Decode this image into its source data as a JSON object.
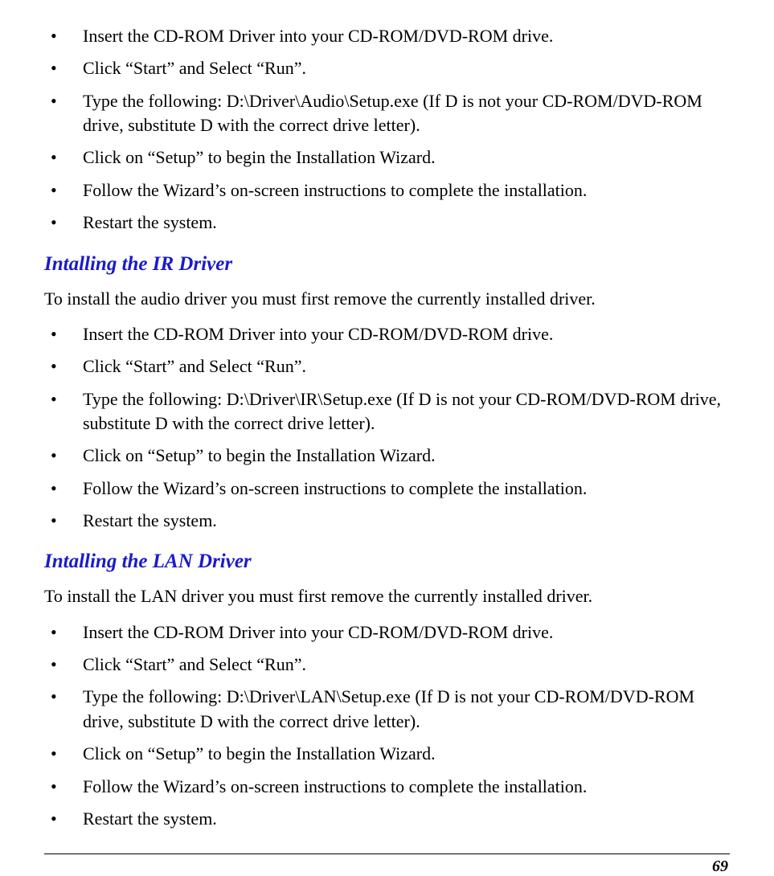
{
  "sections": [
    {
      "heading": null,
      "intro": null,
      "items": [
        "Insert the CD-ROM Driver into your CD-ROM/DVD-ROM drive.",
        "Click “Start” and Select “Run”.",
        "Type the following: D:\\Driver\\Audio\\Setup.exe (If D is not your CD-ROM/DVD-ROM drive, substitute D with the correct drive letter).",
        "Click on “Setup” to begin the Installation Wizard.",
        "Follow the Wizard’s on-screen instructions to complete the installation.",
        "Restart the system."
      ]
    },
    {
      "heading": "Intalling the IR Driver",
      "intro": "To install the audio driver you must first remove the currently installed driver.",
      "items": [
        "Insert the CD-ROM Driver into your CD-ROM/DVD-ROM drive.",
        "Click “Start” and Select “Run”.",
        "Type the following: D:\\Driver\\IR\\Setup.exe (If D is not your CD-ROM/DVD-ROM drive, substitute D with the correct drive letter).",
        "Click on “Setup” to begin the Installation Wizard.",
        "Follow the Wizard’s on-screen instructions to complete the installation.",
        "Restart the system."
      ]
    },
    {
      "heading": "Intalling the LAN Driver",
      "intro": "To install the LAN driver you must first remove the currently installed driver.",
      "items": [
        "Insert the CD-ROM Driver into your CD-ROM/DVD-ROM drive.",
        "Click “Start” and Select “Run”.",
        "Type the following: D:\\Driver\\LAN\\Setup.exe (If D is not your CD-ROM/DVD-ROM drive, substitute D with the correct drive letter).",
        "Click on “Setup” to begin the Installation Wizard.",
        "Follow the Wizard’s on-screen instructions to complete the installation.",
        "Restart the system."
      ]
    }
  ],
  "page_number": "69"
}
